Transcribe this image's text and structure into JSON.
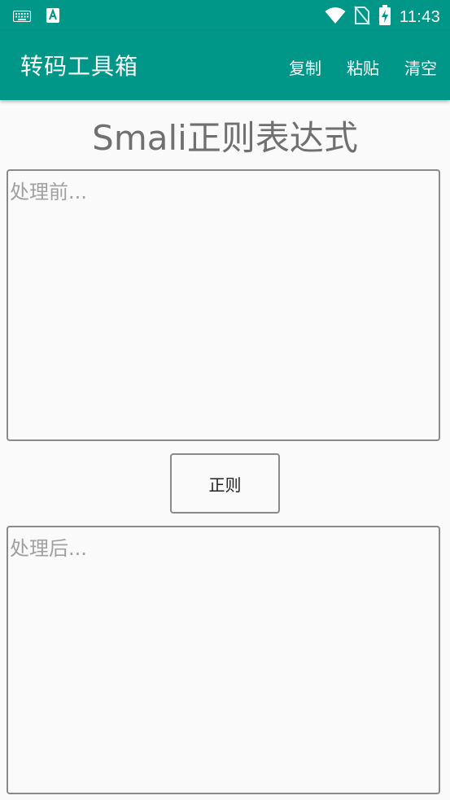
{
  "status_bar": {
    "time": "11:43",
    "icons": [
      "keyboard-icon",
      "accessibility-icon",
      "wifi-icon",
      "no-sim-icon",
      "battery-charging-icon"
    ]
  },
  "app_bar": {
    "title": "转码工具箱",
    "actions": {
      "copy": "复制",
      "paste": "粘贴",
      "clear": "清空"
    }
  },
  "main": {
    "heading": "Smali正则表达式",
    "input_placeholder": "处理前...",
    "input_value": "",
    "button_label": "正则",
    "output_placeholder": "处理后...",
    "output_value": ""
  },
  "colors": {
    "primary": "#009688",
    "background": "#fafafa",
    "border": "#8a8a8a",
    "heading_text": "#707070"
  }
}
